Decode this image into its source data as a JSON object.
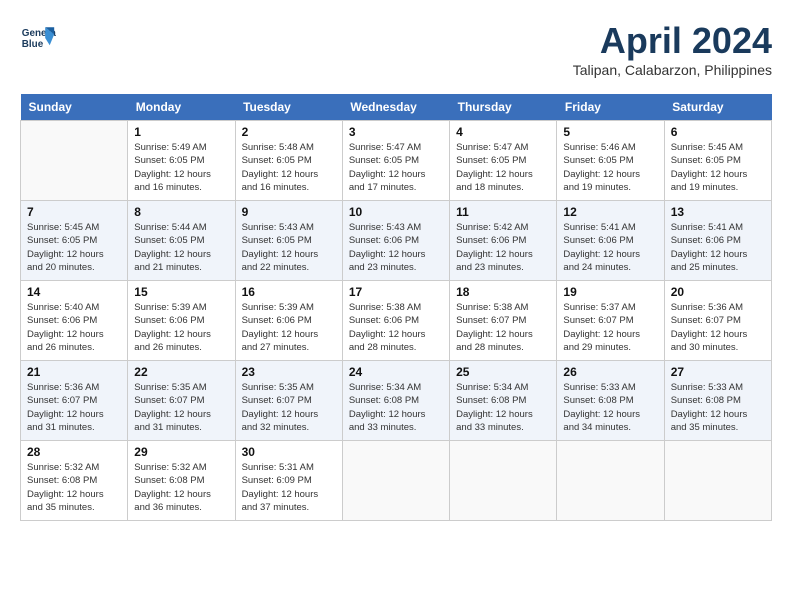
{
  "header": {
    "logo_line1": "General",
    "logo_line2": "Blue",
    "month": "April 2024",
    "location": "Talipan, Calabarzon, Philippines"
  },
  "weekdays": [
    "Sunday",
    "Monday",
    "Tuesday",
    "Wednesday",
    "Thursday",
    "Friday",
    "Saturday"
  ],
  "weeks": [
    [
      {
        "num": "",
        "sunrise": "",
        "sunset": "",
        "daylight": ""
      },
      {
        "num": "1",
        "sunrise": "Sunrise: 5:49 AM",
        "sunset": "Sunset: 6:05 PM",
        "daylight": "Daylight: 12 hours and 16 minutes."
      },
      {
        "num": "2",
        "sunrise": "Sunrise: 5:48 AM",
        "sunset": "Sunset: 6:05 PM",
        "daylight": "Daylight: 12 hours and 16 minutes."
      },
      {
        "num": "3",
        "sunrise": "Sunrise: 5:47 AM",
        "sunset": "Sunset: 6:05 PM",
        "daylight": "Daylight: 12 hours and 17 minutes."
      },
      {
        "num": "4",
        "sunrise": "Sunrise: 5:47 AM",
        "sunset": "Sunset: 6:05 PM",
        "daylight": "Daylight: 12 hours and 18 minutes."
      },
      {
        "num": "5",
        "sunrise": "Sunrise: 5:46 AM",
        "sunset": "Sunset: 6:05 PM",
        "daylight": "Daylight: 12 hours and 19 minutes."
      },
      {
        "num": "6",
        "sunrise": "Sunrise: 5:45 AM",
        "sunset": "Sunset: 6:05 PM",
        "daylight": "Daylight: 12 hours and 19 minutes."
      }
    ],
    [
      {
        "num": "7",
        "sunrise": "Sunrise: 5:45 AM",
        "sunset": "Sunset: 6:05 PM",
        "daylight": "Daylight: 12 hours and 20 minutes."
      },
      {
        "num": "8",
        "sunrise": "Sunrise: 5:44 AM",
        "sunset": "Sunset: 6:05 PM",
        "daylight": "Daylight: 12 hours and 21 minutes."
      },
      {
        "num": "9",
        "sunrise": "Sunrise: 5:43 AM",
        "sunset": "Sunset: 6:05 PM",
        "daylight": "Daylight: 12 hours and 22 minutes."
      },
      {
        "num": "10",
        "sunrise": "Sunrise: 5:43 AM",
        "sunset": "Sunset: 6:06 PM",
        "daylight": "Daylight: 12 hours and 23 minutes."
      },
      {
        "num": "11",
        "sunrise": "Sunrise: 5:42 AM",
        "sunset": "Sunset: 6:06 PM",
        "daylight": "Daylight: 12 hours and 23 minutes."
      },
      {
        "num": "12",
        "sunrise": "Sunrise: 5:41 AM",
        "sunset": "Sunset: 6:06 PM",
        "daylight": "Daylight: 12 hours and 24 minutes."
      },
      {
        "num": "13",
        "sunrise": "Sunrise: 5:41 AM",
        "sunset": "Sunset: 6:06 PM",
        "daylight": "Daylight: 12 hours and 25 minutes."
      }
    ],
    [
      {
        "num": "14",
        "sunrise": "Sunrise: 5:40 AM",
        "sunset": "Sunset: 6:06 PM",
        "daylight": "Daylight: 12 hours and 26 minutes."
      },
      {
        "num": "15",
        "sunrise": "Sunrise: 5:39 AM",
        "sunset": "Sunset: 6:06 PM",
        "daylight": "Daylight: 12 hours and 26 minutes."
      },
      {
        "num": "16",
        "sunrise": "Sunrise: 5:39 AM",
        "sunset": "Sunset: 6:06 PM",
        "daylight": "Daylight: 12 hours and 27 minutes."
      },
      {
        "num": "17",
        "sunrise": "Sunrise: 5:38 AM",
        "sunset": "Sunset: 6:06 PM",
        "daylight": "Daylight: 12 hours and 28 minutes."
      },
      {
        "num": "18",
        "sunrise": "Sunrise: 5:38 AM",
        "sunset": "Sunset: 6:07 PM",
        "daylight": "Daylight: 12 hours and 28 minutes."
      },
      {
        "num": "19",
        "sunrise": "Sunrise: 5:37 AM",
        "sunset": "Sunset: 6:07 PM",
        "daylight": "Daylight: 12 hours and 29 minutes."
      },
      {
        "num": "20",
        "sunrise": "Sunrise: 5:36 AM",
        "sunset": "Sunset: 6:07 PM",
        "daylight": "Daylight: 12 hours and 30 minutes."
      }
    ],
    [
      {
        "num": "21",
        "sunrise": "Sunrise: 5:36 AM",
        "sunset": "Sunset: 6:07 PM",
        "daylight": "Daylight: 12 hours and 31 minutes."
      },
      {
        "num": "22",
        "sunrise": "Sunrise: 5:35 AM",
        "sunset": "Sunset: 6:07 PM",
        "daylight": "Daylight: 12 hours and 31 minutes."
      },
      {
        "num": "23",
        "sunrise": "Sunrise: 5:35 AM",
        "sunset": "Sunset: 6:07 PM",
        "daylight": "Daylight: 12 hours and 32 minutes."
      },
      {
        "num": "24",
        "sunrise": "Sunrise: 5:34 AM",
        "sunset": "Sunset: 6:08 PM",
        "daylight": "Daylight: 12 hours and 33 minutes."
      },
      {
        "num": "25",
        "sunrise": "Sunrise: 5:34 AM",
        "sunset": "Sunset: 6:08 PM",
        "daylight": "Daylight: 12 hours and 33 minutes."
      },
      {
        "num": "26",
        "sunrise": "Sunrise: 5:33 AM",
        "sunset": "Sunset: 6:08 PM",
        "daylight": "Daylight: 12 hours and 34 minutes."
      },
      {
        "num": "27",
        "sunrise": "Sunrise: 5:33 AM",
        "sunset": "Sunset: 6:08 PM",
        "daylight": "Daylight: 12 hours and 35 minutes."
      }
    ],
    [
      {
        "num": "28",
        "sunrise": "Sunrise: 5:32 AM",
        "sunset": "Sunset: 6:08 PM",
        "daylight": "Daylight: 12 hours and 35 minutes."
      },
      {
        "num": "29",
        "sunrise": "Sunrise: 5:32 AM",
        "sunset": "Sunset: 6:08 PM",
        "daylight": "Daylight: 12 hours and 36 minutes."
      },
      {
        "num": "30",
        "sunrise": "Sunrise: 5:31 AM",
        "sunset": "Sunset: 6:09 PM",
        "daylight": "Daylight: 12 hours and 37 minutes."
      },
      {
        "num": "",
        "sunrise": "",
        "sunset": "",
        "daylight": ""
      },
      {
        "num": "",
        "sunrise": "",
        "sunset": "",
        "daylight": ""
      },
      {
        "num": "",
        "sunrise": "",
        "sunset": "",
        "daylight": ""
      },
      {
        "num": "",
        "sunrise": "",
        "sunset": "",
        "daylight": ""
      }
    ]
  ]
}
